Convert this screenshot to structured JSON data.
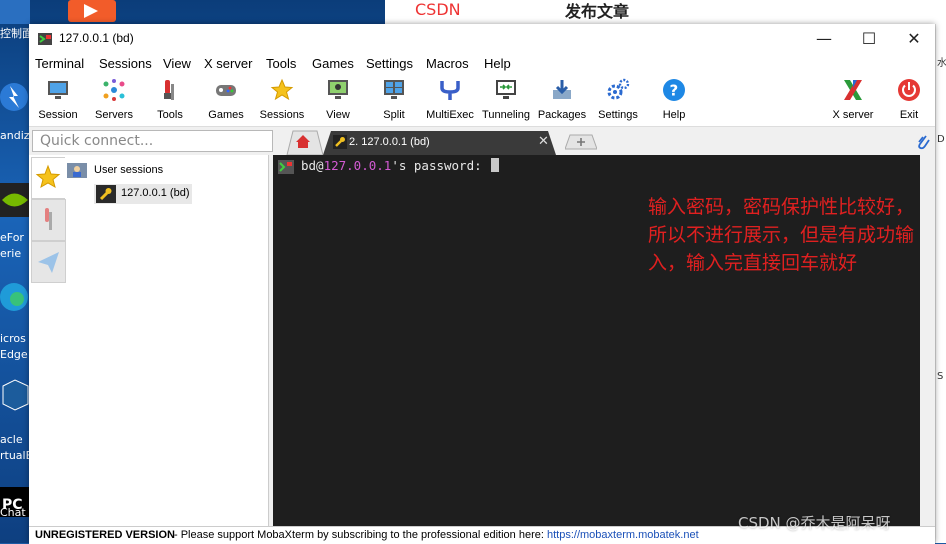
{
  "desktop": {
    "icons": [
      "控制面",
      "andiz",
      "eFor",
      "erie",
      "icros",
      "Edge",
      "acle",
      "rtualB",
      "Chat"
    ],
    "browser_brand": "CSDN",
    "browser_title": "发布文章",
    "right_strip_text": [
      "水",
      "D",
      "S"
    ]
  },
  "window": {
    "title": "127.0.0.1 (bd)",
    "minimize": "—",
    "maximize": "☐",
    "close": "✕"
  },
  "menu": [
    "Terminal",
    "Sessions",
    "View",
    "X server",
    "Tools",
    "Games",
    "Settings",
    "Macros",
    "Help"
  ],
  "toolbar": {
    "items": [
      {
        "label": "Session",
        "icon": "monitor-icon"
      },
      {
        "label": "Servers",
        "icon": "network-icon"
      },
      {
        "label": "Tools",
        "icon": "tools-icon"
      },
      {
        "label": "Games",
        "icon": "gamepad-icon"
      },
      {
        "label": "Sessions",
        "icon": "star-icon"
      },
      {
        "label": "View",
        "icon": "view-icon"
      },
      {
        "label": "Split",
        "icon": "split-icon"
      },
      {
        "label": "MultiExec",
        "icon": "fork-icon"
      },
      {
        "label": "Tunneling",
        "icon": "tunnel-icon"
      },
      {
        "label": "Packages",
        "icon": "download-icon"
      },
      {
        "label": "Settings",
        "icon": "gears-icon"
      },
      {
        "label": "Help",
        "icon": "help-icon"
      }
    ],
    "xserver_label": "X server",
    "exit_label": "Exit"
  },
  "quick_connect": {
    "placeholder": "Quick connect..."
  },
  "tabs": {
    "active_label": "2. 127.0.0.1 (bd)",
    "close": "✕"
  },
  "sidebar": {
    "root_label": "User sessions",
    "child_label": "127.0.0.1 (bd)"
  },
  "terminal": {
    "user": "bd@",
    "host": "127.0.0.1",
    "prompt_rest": "'s password: "
  },
  "annotation": "输入密码，密码保护性比较好，所以不进行展示，但是有成功输入，输入完直接回车就好",
  "statusbar": {
    "unregistered": "UNREGISTERED VERSION",
    "message": "-  Please support MobaXterm by subscribing to the professional edition here:",
    "link": "https://mobaxterm.mobatek.net"
  },
  "watermark": "CSDN @乔木是阿呆呀",
  "colors": {
    "terminal_bg": "#1e1e1e",
    "host": "#d25ad2",
    "annotation": "#e02020",
    "tab_active": "#3a3a3a"
  }
}
